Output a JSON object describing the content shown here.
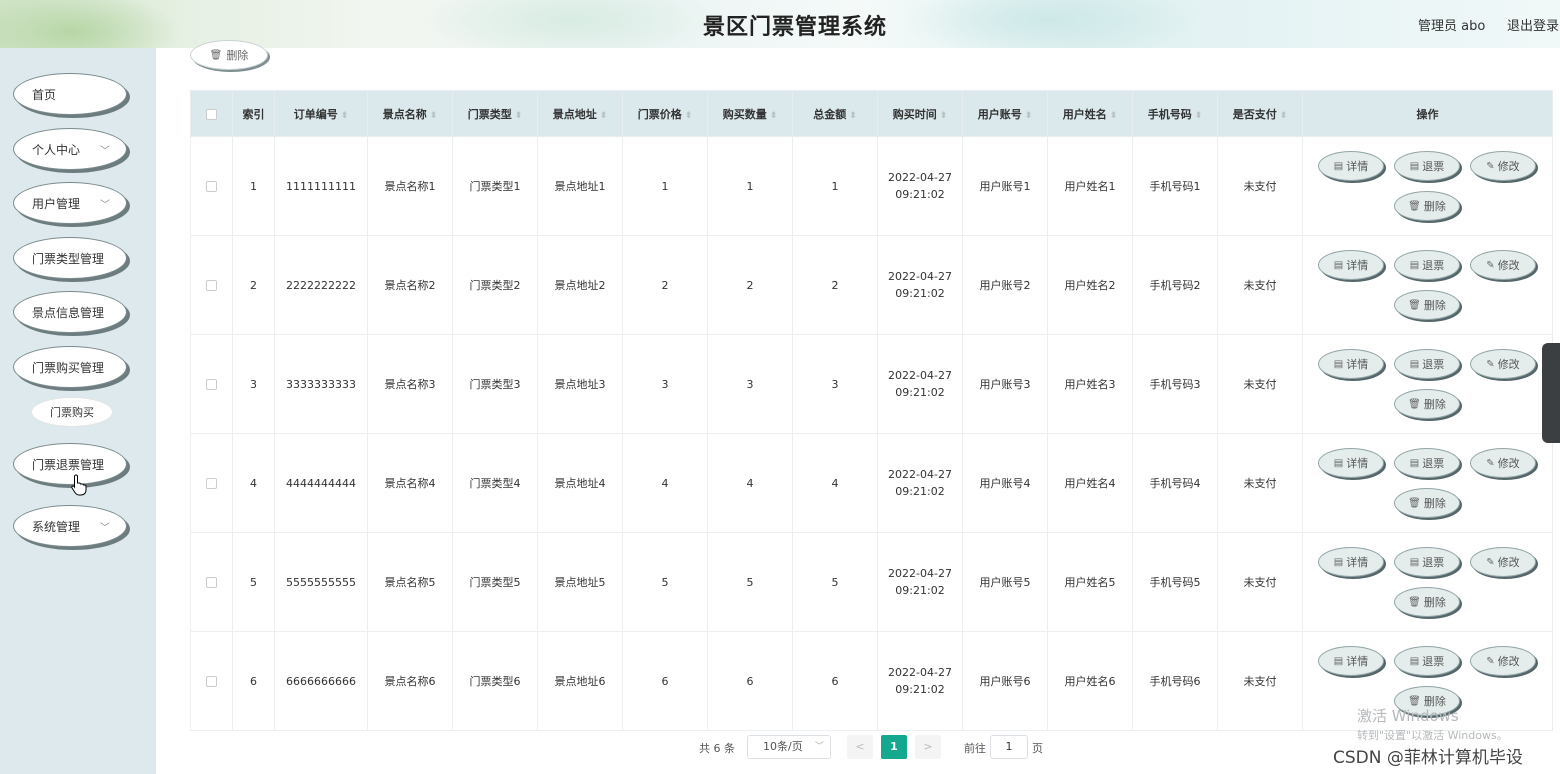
{
  "header": {
    "title": "景区门票管理系统",
    "admin": "管理员 abo",
    "logout": "退出登录"
  },
  "sidebar": {
    "items": [
      {
        "label": "首页",
        "arrow": ""
      },
      {
        "label": "个人中心",
        "arrow": "﹀"
      },
      {
        "label": "用户管理",
        "arrow": "﹀"
      },
      {
        "label": "门票类型管理",
        "arrow": ""
      },
      {
        "label": "景点信息管理",
        "arrow": ""
      },
      {
        "label": "门票购买管理",
        "arrow": ""
      },
      {
        "label": "门票退票管理",
        "arrow": ""
      },
      {
        "label": "系统管理",
        "arrow": "﹀"
      }
    ],
    "sub_item": "门票购买"
  },
  "toolbar": {
    "delete_label": "删除"
  },
  "table": {
    "headers": [
      "索引",
      "订单编号",
      "景点名称",
      "门票类型",
      "景点地址",
      "门票价格",
      "购买数量",
      "总金额",
      "购买时间",
      "用户账号",
      "用户姓名",
      "手机号码",
      "是否支付",
      "操作"
    ],
    "rows": [
      {
        "idx": "1",
        "order": "1111111111",
        "name": "景点名称1",
        "type": "门票类型1",
        "addr": "景点地址1",
        "price": "1",
        "qty": "1",
        "total": "1",
        "date": "2022-04-27",
        "time": "09:21:02",
        "account": "用户账号1",
        "uname": "用户姓名1",
        "phone": "手机号码1",
        "paid": "未支付"
      },
      {
        "idx": "2",
        "order": "2222222222",
        "name": "景点名称2",
        "type": "门票类型2",
        "addr": "景点地址2",
        "price": "2",
        "qty": "2",
        "total": "2",
        "date": "2022-04-27",
        "time": "09:21:02",
        "account": "用户账号2",
        "uname": "用户姓名2",
        "phone": "手机号码2",
        "paid": "未支付"
      },
      {
        "idx": "3",
        "order": "3333333333",
        "name": "景点名称3",
        "type": "门票类型3",
        "addr": "景点地址3",
        "price": "3",
        "qty": "3",
        "total": "3",
        "date": "2022-04-27",
        "time": "09:21:02",
        "account": "用户账号3",
        "uname": "用户姓名3",
        "phone": "手机号码3",
        "paid": "未支付"
      },
      {
        "idx": "4",
        "order": "4444444444",
        "name": "景点名称4",
        "type": "门票类型4",
        "addr": "景点地址4",
        "price": "4",
        "qty": "4",
        "total": "4",
        "date": "2022-04-27",
        "time": "09:21:02",
        "account": "用户账号4",
        "uname": "用户姓名4",
        "phone": "手机号码4",
        "paid": "未支付"
      },
      {
        "idx": "5",
        "order": "5555555555",
        "name": "景点名称5",
        "type": "门票类型5",
        "addr": "景点地址5",
        "price": "5",
        "qty": "5",
        "total": "5",
        "date": "2022-04-27",
        "time": "09:21:02",
        "account": "用户账号5",
        "uname": "用户姓名5",
        "phone": "手机号码5",
        "paid": "未支付"
      },
      {
        "idx": "6",
        "order": "6666666666",
        "name": "景点名称6",
        "type": "门票类型6",
        "addr": "景点地址6",
        "price": "6",
        "qty": "6",
        "total": "6",
        "date": "2022-04-27",
        "time": "09:21:02",
        "account": "用户账号6",
        "uname": "用户姓名6",
        "phone": "手机号码6",
        "paid": "未支付"
      }
    ],
    "actions": {
      "detail": "详情",
      "refund": "退票",
      "edit": "修改",
      "delete": "删除"
    }
  },
  "pagination": {
    "total": "共 6 条",
    "page_size": "10条/页",
    "current": "1",
    "goto_label": "前往",
    "goto_value": "1",
    "page_suffix": "页"
  },
  "watermark": {
    "line1": "激活 Windows",
    "line2": "转到\"设置\"以激活 Windows。",
    "line3": "CSDN @菲林计算机毕设"
  },
  "colors": {
    "accent": "#14a88f",
    "sidebar_bg": "#dde9ec",
    "table_header_bg": "#dbe9ed"
  }
}
